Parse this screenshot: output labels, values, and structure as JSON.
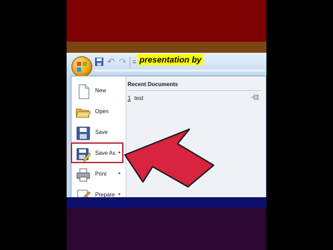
{
  "quick_access": {
    "title_caption": "presentation by",
    "more_symbol": "="
  },
  "icons": [
    "office-button-icon",
    "save-icon",
    "undo-icon",
    "redo-icon",
    "new-document-icon",
    "open-folder-icon",
    "save-disk-icon",
    "save-as-icon",
    "printer-icon",
    "prepare-icon",
    "pin-icon",
    "red-pointer-arrow"
  ],
  "office_menu": {
    "items": [
      {
        "label": "New",
        "has_submenu": false
      },
      {
        "label": "Open",
        "has_submenu": false
      },
      {
        "label": "Save",
        "has_submenu": false
      },
      {
        "label": "Save As",
        "has_submenu": true,
        "highlighted": true
      },
      {
        "label": "Print",
        "has_submenu": true
      },
      {
        "label": "Prepare",
        "has_submenu": true
      }
    ],
    "submenu_arrow": "▸",
    "recent_documents": {
      "title": "Recent Documents",
      "items": [
        {
          "number": "1",
          "name": "test"
        }
      ]
    }
  },
  "colors": {
    "top_band": "#7d0101",
    "brown_band": "#7b4513",
    "navy_band": "#0d0f6b",
    "purple_band": "#2b0731",
    "highlight_box": "#b83040",
    "arrow_fill": "#d8243f",
    "caption_bg": "#ffff00"
  }
}
